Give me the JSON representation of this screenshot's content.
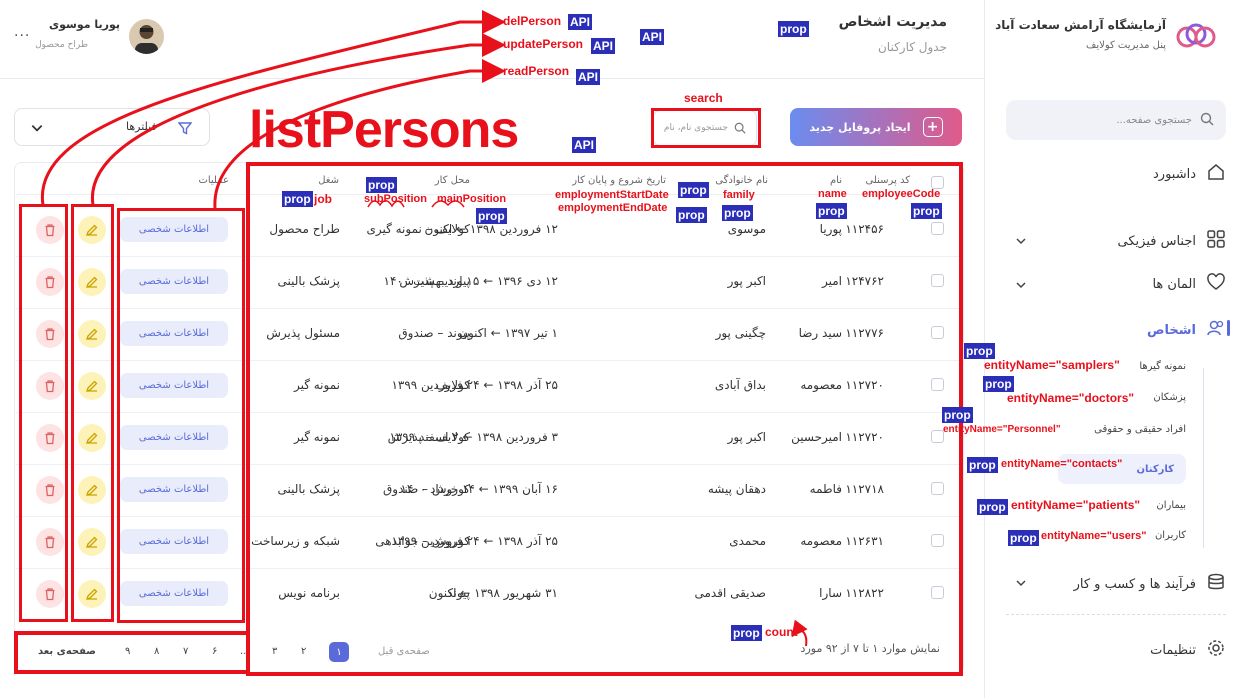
{
  "app": {
    "name": "آزمایشگاه آرامش سعادت آباد",
    "subtitle": "پنل مدیریت کولایف",
    "search_placeholder": "جستجوی صفحه..."
  },
  "header": {
    "title": "مدیریت اشخاص",
    "subtitle": "جدول کارکنان",
    "user_name": "پوریا موسوی",
    "user_role": "طراح محصول",
    "more": "..."
  },
  "sidebar": {
    "items": [
      {
        "label": "داشبورد"
      },
      {
        "label": "اجناس فیزیکی"
      },
      {
        "label": "المان ها"
      },
      {
        "label": "اشخاص"
      },
      {
        "label": "فرآیند ها و کسب و کار"
      },
      {
        "label": "تنظیمات"
      }
    ],
    "sub_items": [
      {
        "label": "نمونه گیرها"
      },
      {
        "label": "پزشکان"
      },
      {
        "label": "افراد حقیقی و حقوقی"
      },
      {
        "label": "کارکنان"
      },
      {
        "label": "بیماران"
      },
      {
        "label": "کاربران"
      }
    ]
  },
  "toolbar": {
    "create_label": "ایجاد پروفایل جدید",
    "search_placeholder": "جستجوی نام، نام",
    "filters_label": "فیلترها"
  },
  "table": {
    "headers": {
      "code": "کد پرسنلی",
      "name": "نام",
      "family": "نام خانوادگی",
      "dates": "تاریخ شروع و پایان کار",
      "place": "محل کار",
      "job": "شغل",
      "ops": "عملیات"
    },
    "info_label": "اطلاعات شخصی",
    "rows": [
      {
        "code": "۱۱۲۴۵۶",
        "name": "پوریا",
        "family": "موسوی",
        "dates": "۱۲ فروردین ۱۳۹۸ ← اکنون",
        "place": "کولایف – نمونه گیری",
        "job": "طراح محصول"
      },
      {
        "code": "۱۲۴۷۶۲",
        "name": "امیر",
        "family": "اکبر پور",
        "dates": "۱۲ دی ۱۳۹۶ ← ۱۵ اردیبهشت ۱۴۰۰",
        "place": "پیوند – پذیرش",
        "job": "پزشک بالینی"
      },
      {
        "code": "۱۱۲۷۷۶",
        "name": "سید رضا",
        "family": "چگینی پور",
        "dates": "۱ تیر ۱۳۹۷ ← اکنون",
        "place": "پیوند – صندوق",
        "job": "مسئول پذیرش"
      },
      {
        "code": "۱۱۲۷۲۰",
        "name": "معصومه",
        "family": "بداق آبادی",
        "dates": "۲۵ آذر ۱۳۹۸ ← ۲۴ فروردین ۱۳۹۹",
        "place": "کولایف",
        "job": "نمونه گیر"
      },
      {
        "code": "۱۱۲۷۲۰",
        "name": "امیرحسین",
        "family": "اکبر پور",
        "dates": "۳ فروردین ۱۳۹۸ ← ۲ اسفند ۱۳۹۹",
        "place": "کولایف – پذیرش",
        "job": "نمونه گیر"
      },
      {
        "code": "۱۱۲۷۱۸",
        "name": "فاطمه",
        "family": "دهقان پیشه",
        "dates": "۱۶ آبان ۱۳۹۹ ← ۱۴ خرداد ۱۴۰۰",
        "place": "کوروش – صندوق",
        "job": "پزشک بالینی"
      },
      {
        "code": "۱۱۲۶۳۱",
        "name": "معصومه",
        "family": "محمدی",
        "dates": "۲۵ آذر ۱۳۹۸ ← ۲۴ فروردین ۱۳۹۹",
        "place": "کوروش – جوابدهی",
        "job": "شبکه و زیرساخت"
      },
      {
        "code": "۱۱۲۸۲۲",
        "name": "سارا",
        "family": "صدیقی اقدمی",
        "dates": "۳۱ شهریور ۱۳۹۸ ← اکنون",
        "place": "پیوند",
        "job": "برنامه نویس"
      }
    ]
  },
  "pagination": {
    "summary": "نمایش موارد ۱ تا ۷ از ۹۲ مورد",
    "prev": "صفحه‌ی قبل",
    "next": "صفحه‌ی بعد",
    "pages": [
      "۱",
      "۲",
      "۳",
      "...",
      "۶",
      "۷",
      "۸",
      "۹"
    ],
    "active": "۱"
  },
  "annotations": {
    "api": "API",
    "prop": "prop",
    "delPerson": "delPerson",
    "updatePerson": "updatePerson",
    "readPerson": "readPerson",
    "listPersons": "listPersons",
    "search": "search",
    "employeeCode": "employeeCode",
    "name": "name",
    "family": "family",
    "employmentStartDate": "employmentStartDate",
    "employmentEndDate": "employmentEndDate",
    "mainPosition": "mainPosition",
    "subPosition": "subPosition",
    "job": "job",
    "count": "count",
    "samplers": "entityName=\"samplers\"",
    "doctors": "entityName=\"doctors\"",
    "personnel": "entityName=\"Personnel\"",
    "contacts": "entityName=\"contacts\"",
    "patients": "entityName=\"patients\"",
    "users": "entityName=\"users\""
  },
  "colors": {
    "accent": "#5a6ad8",
    "annotation_red": "#e8101a",
    "annotation_blue": "#2b2fb8",
    "edit_bg": "#fdf2b8",
    "delete_bg": "#fde3e3"
  }
}
